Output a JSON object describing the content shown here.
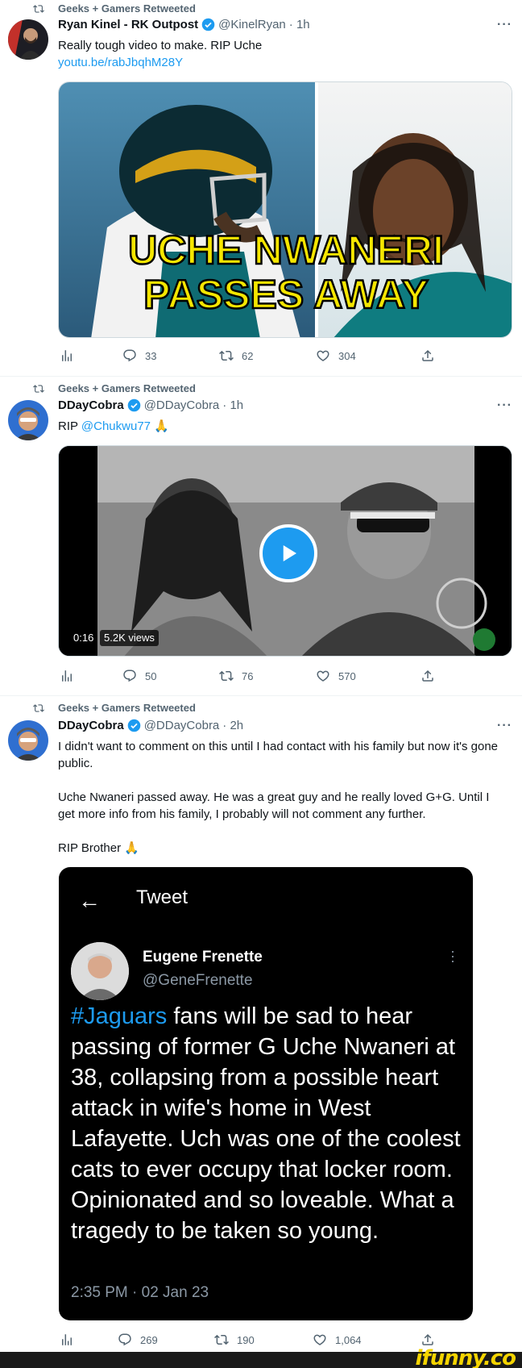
{
  "tweets": [
    {
      "retweeted_by": "Geeks + Gamers Retweeted",
      "name": "Ryan Kinel - RK Outpost",
      "handle": "@KinelRyan",
      "time": "· 1h",
      "text": "Really tough video to make. RIP Uche",
      "link": "youtu.be/rabJbqhM28Y",
      "thumb_line1": "UCHE NWANERI",
      "thumb_line2": "PASSES AWAY",
      "replies": "33",
      "retweets": "62",
      "likes": "304"
    },
    {
      "retweeted_by": "Geeks + Gamers Retweeted",
      "name": "DDayCobra",
      "handle": "@DDayCobra",
      "time": "· 1h",
      "text_prefix": "RIP ",
      "mention": "@Chukwu77",
      "emoji": "🙏",
      "video_time": "0:16",
      "video_views": "5.2K views",
      "replies": "50",
      "retweets": "76",
      "likes": "570"
    },
    {
      "retweeted_by": "Geeks + Gamers Retweeted",
      "name": "DDayCobra",
      "handle": "@DDayCobra",
      "time": "· 2h",
      "para1": "I didn't want to comment on this until I had contact with his family but now it's gone public.",
      "para2": "Uche Nwaneri passed away. He was a great guy and he really loved G+G. Until I get more info from his family, I probably will not comment any further.",
      "para3": "RIP Brother 🙏",
      "embed": {
        "header": "Tweet",
        "name": "Eugene Frenette",
        "handle": "@GeneFrenette",
        "hashtag": "#Jaguars",
        "text": " fans will be sad to hear passing of former G Uche Nwaneri at 38, collapsing from a possible heart attack in wife's home in West Lafayette. Uch was one of the coolest cats to ever occupy that locker room. Opinionated and so loveable. What a tragedy to be taken so young.",
        "time": "2:35 PM · 02 Jan 23"
      },
      "replies": "269",
      "retweets": "190",
      "likes": "1,064"
    }
  ],
  "watermark": "ifunny.co",
  "colors": {
    "accent": "#1d9bf0",
    "muted": "#536471",
    "thumb_text": "#f5e600"
  }
}
